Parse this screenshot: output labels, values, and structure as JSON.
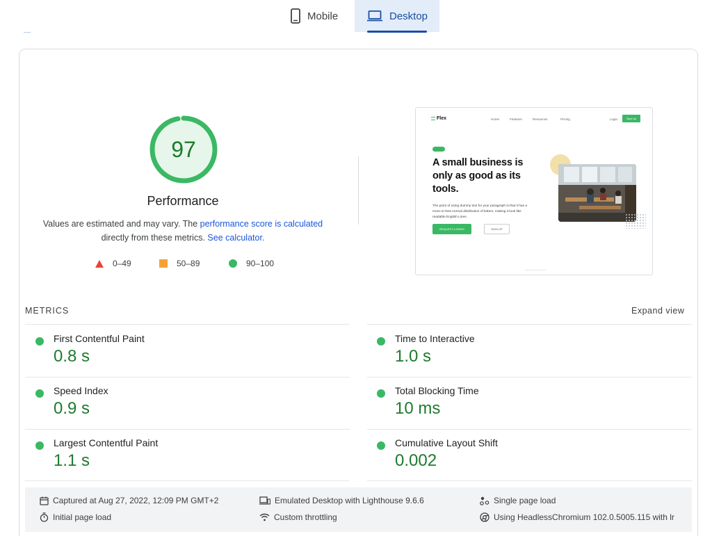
{
  "tabs": {
    "mobile": "Mobile",
    "desktop": "Desktop"
  },
  "score": {
    "value": "97",
    "fraction": 0.97,
    "title": "Performance",
    "desc_text1": "Values are estimated and may vary. The ",
    "desc_link1": "performance score is calculated",
    "desc_text2": "directly from these metrics. ",
    "desc_link2": "See calculator."
  },
  "legend": {
    "fail": "0–49",
    "average": "50–89",
    "pass": "90–100"
  },
  "thumbnail": {
    "logo": "Flex",
    "nav": [
      "Home",
      "Features",
      "Resources",
      "Pricing"
    ],
    "login": "Login",
    "signup": "Sign Up",
    "headline": "A small business is only as good as its tools.",
    "body": "The point of using dummy text for your paragraph is that it has a more-or-less normal distribution of letters, making it look like readable English Lines.",
    "cta_primary": "REQUEST A DEMO",
    "cta_secondary": "SIGN UP"
  },
  "metrics": {
    "label": "METRICS",
    "expand": "Expand view",
    "items": [
      {
        "name": "First Contentful Paint",
        "value": "0.8 s"
      },
      {
        "name": "Time to Interactive",
        "value": "1.0 s"
      },
      {
        "name": "Speed Index",
        "value": "0.9 s"
      },
      {
        "name": "Total Blocking Time",
        "value": "10 ms"
      },
      {
        "name": "Largest Contentful Paint",
        "value": "1.1 s"
      },
      {
        "name": "Cumulative Layout Shift",
        "value": "0.002"
      }
    ]
  },
  "footer": {
    "captured": "Captured at Aug 27, 2022, 12:09 PM GMT+2",
    "emulated": "Emulated Desktop with Lighthouse 9.6.6",
    "single": "Single page load",
    "initial": "Initial page load",
    "throttling": "Custom throttling",
    "browser": "Using HeadlessChromium 102.0.5005.115 with lr"
  },
  "colors": {
    "pass": "#3ab864",
    "average": "#f4a236",
    "fail": "#eb4436",
    "score_text": "#1e7a2e",
    "link": "#1a56db",
    "accent": "#1a4fa3"
  }
}
